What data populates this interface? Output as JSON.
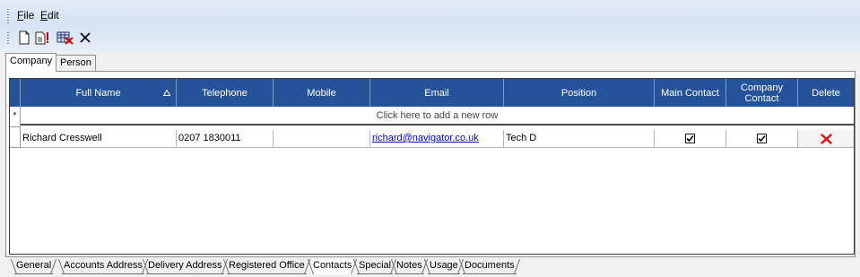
{
  "menu": {
    "file_label": "File",
    "file_mnemonic": "F",
    "file_rest": "ile",
    "edit_label": "Edit",
    "edit_mnemonic": "E",
    "edit_rest": "dit"
  },
  "toolbar": {
    "icons": [
      "new-document-icon",
      "edit-document-icon",
      "remove-filter-icon",
      "delete-icon"
    ]
  },
  "top_tabs": [
    {
      "label": "Company",
      "active": true
    },
    {
      "label": "Person",
      "active": false
    }
  ],
  "grid": {
    "columns": [
      {
        "label": "Full Name",
        "sorted": "ascending"
      },
      {
        "label": "Telephone"
      },
      {
        "label": "Mobile"
      },
      {
        "label": "Email"
      },
      {
        "label": "Position"
      },
      {
        "label": "Main Contact"
      },
      {
        "label": "Company Contact"
      },
      {
        "label": "Delete"
      }
    ],
    "new_row_marker": "*",
    "add_row_text": "Click here to add a new row",
    "rows": [
      {
        "full_name": "Richard Cresswell",
        "telephone": "0207 1830011",
        "mobile": "",
        "email": "richard@navigator.co.uk",
        "position": "Tech D",
        "main_contact": true,
        "company_contact": true
      }
    ]
  },
  "bottom_tabs": [
    {
      "label": "General",
      "active": false
    },
    {
      "label": "Accounts Address",
      "active": false
    },
    {
      "label": "Delivery Address",
      "active": false
    },
    {
      "label": "Registered Office",
      "active": false
    },
    {
      "label": "Contacts",
      "active": true
    },
    {
      "label": "Special",
      "active": false
    },
    {
      "label": "Notes",
      "active": false
    },
    {
      "label": "Usage",
      "active": false
    },
    {
      "label": "Documents",
      "active": false
    }
  ],
  "colors": {
    "header_bg": "#24539a",
    "delete_icon": "#e01010",
    "link": "#0000cc"
  }
}
